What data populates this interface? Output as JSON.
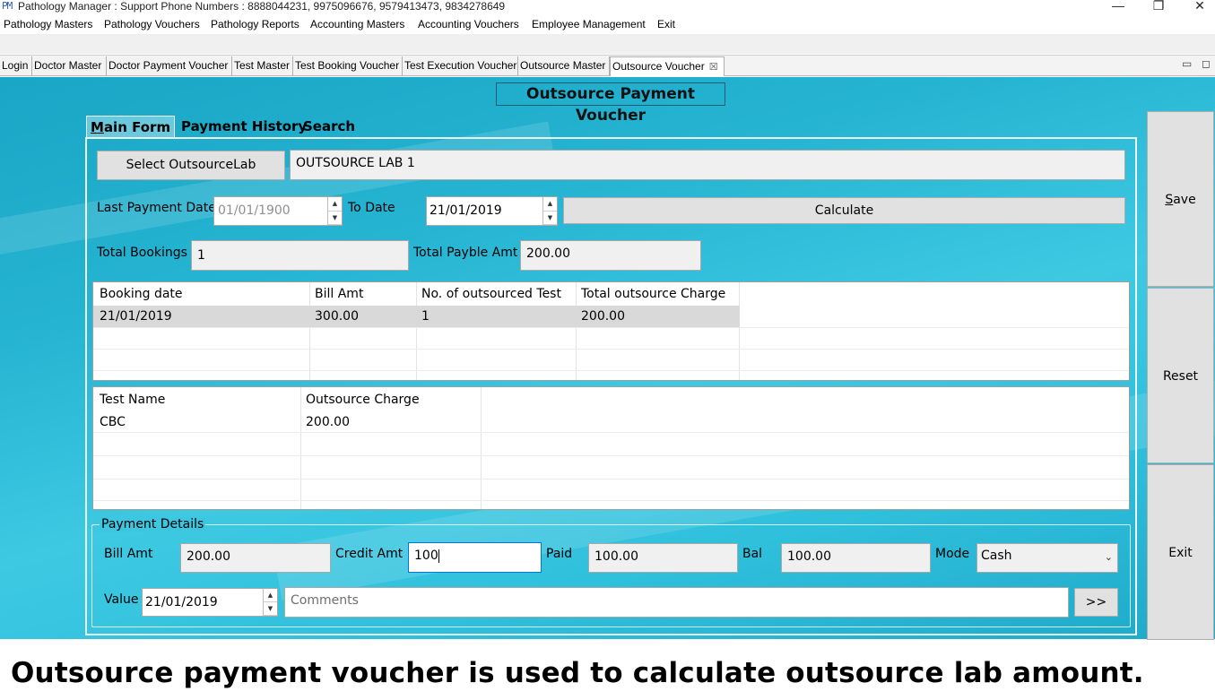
{
  "window": {
    "app_icon": "PM",
    "title": "Pathology Manager : Support Phone Numbers : 8888044231, 9975096676, 9579413473, 9834278649",
    "minimize": "—",
    "restore": "❐",
    "close": "✕"
  },
  "menu": [
    "Pathology Masters",
    "Pathology Vouchers",
    "Pathology Reports",
    "Accounting Masters",
    "Accounting Vouchers",
    "Employee Management",
    "Exit"
  ],
  "doc_tabs": [
    "Login",
    "Doctor Master",
    "Doctor Payment Voucher",
    "Test Master",
    "Test Booking Voucher",
    "Test Execution Voucher",
    "Outsource Master",
    "Outsource Voucher"
  ],
  "doc_tab_close": "☒",
  "tabbar_controls": {
    "minimize": "▭",
    "maximize": "◻"
  },
  "form": {
    "title": "Outsource Payment Voucher",
    "inner_tabs": [
      "Main Form",
      "Payment History",
      "Search"
    ],
    "select_lab_button": "Select OutsourceLab",
    "lab_name": "OUTSOURCE LAB 1",
    "last_payment_date_label": "Last Payment Date",
    "last_payment_date": "01/01/1900",
    "to_date_label": "To Date",
    "to_date": "21/01/2019",
    "calculate_button": "Calculate",
    "total_bookings_label": "Total Bookings",
    "total_bookings": "1",
    "total_payable_label": "Total Payble Amt",
    "total_payable": "200.00"
  },
  "bookings_grid": {
    "columns": [
      "Booking date",
      "Bill Amt",
      "No. of outsourced Test",
      "Total outsource Charge"
    ],
    "rows": [
      [
        "21/01/2019",
        "300.00",
        "1",
        "200.00"
      ]
    ]
  },
  "tests_grid": {
    "columns": [
      "Test Name",
      "Outsource Charge"
    ],
    "rows": [
      [
        "CBC",
        "200.00"
      ]
    ]
  },
  "payment": {
    "group_title": "Payment Details",
    "bill_amt_label": "Bill Amt",
    "bill_amt": "200.00",
    "credit_amt_label": "Credit Amt",
    "credit_amt": "100",
    "paid_label": "Paid",
    "paid": "100.00",
    "bal_label": "Bal",
    "bal": "100.00",
    "mode_label": "Mode",
    "mode": "Cash",
    "value_label": "Value",
    "value_date": "21/01/2019",
    "comments_placeholder": "Comments",
    "more_button": ">>"
  },
  "side_buttons": {
    "save": "Save",
    "reset": "Reset",
    "exit": "Exit"
  },
  "caption": "Outsource payment voucher is used to calculate outsource lab amount.",
  "colors": {
    "background_teal": "#2fbad6",
    "control_gray": "#e1e1e1",
    "field_gray": "#f0f0f0",
    "grid_selection": "#d9d9d9"
  }
}
